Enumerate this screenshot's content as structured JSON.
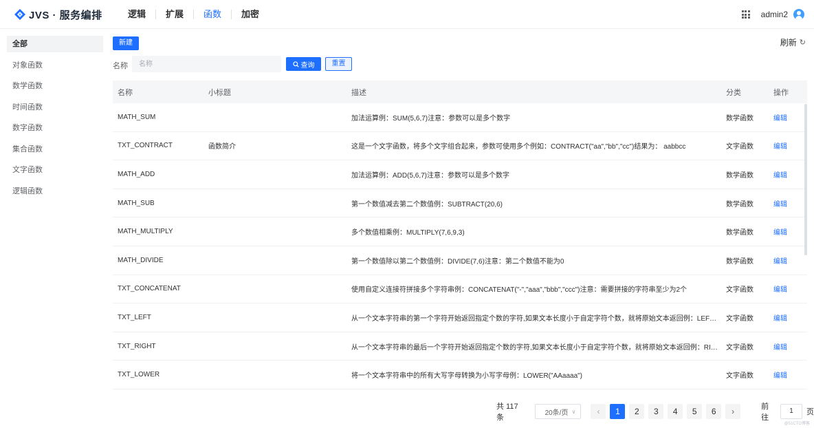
{
  "app": {
    "title": "JVS · 服务编排"
  },
  "nav": {
    "items": [
      "逻辑",
      "扩展",
      "函数",
      "加密"
    ],
    "active_index": 2
  },
  "user": {
    "name": "admin2"
  },
  "sidebar": {
    "items": [
      "全部",
      "对象函数",
      "数学函数",
      "时间函数",
      "数字函数",
      "集合函数",
      "文字函数",
      "逻辑函数"
    ],
    "active_index": 0
  },
  "toolbar": {
    "new_label": "新建",
    "refresh_label": "刷新"
  },
  "filter": {
    "label": "名称",
    "placeholder": "名称",
    "query_label": "查询",
    "reset_label": "重置"
  },
  "table": {
    "headers": {
      "name": "名称",
      "subtitle": "小标题",
      "desc": "描述",
      "category": "分类",
      "op": "操作"
    },
    "rows": [
      {
        "name": "MATH_SUM",
        "subtitle": "",
        "desc": "加法运算例：SUM(5,6,7)注意：参数可以是多个数字",
        "category": "数学函数",
        "op": "编辑"
      },
      {
        "name": "TXT_CONTRACT",
        "subtitle": "函数简介",
        "desc": "这是一个文字函数，将多个文字组合起来，参数可使用多个例如：CONTRACT(\"aa\",\"bb\",\"cc\")结果为： aabbcc",
        "category": "文字函数",
        "op": "编辑"
      },
      {
        "name": "MATH_ADD",
        "subtitle": "",
        "desc": "加法运算例：ADD(5,6,7)注意：参数可以是多个数字",
        "category": "数学函数",
        "op": "编辑"
      },
      {
        "name": "MATH_SUB",
        "subtitle": "",
        "desc": "第一个数值减去第二个数值例：SUBTRACT(20,6)",
        "category": "数学函数",
        "op": "编辑"
      },
      {
        "name": "MATH_MULTIPLY",
        "subtitle": "",
        "desc": "多个数值相乘例：MULTIPLY(7,6,9,3)",
        "category": "数学函数",
        "op": "编辑"
      },
      {
        "name": "MATH_DIVIDE",
        "subtitle": "",
        "desc": "第一个数值除以第二个数值例：DIVIDE(7,6)注意：第二个数值不能为0",
        "category": "数学函数",
        "op": "编辑"
      },
      {
        "name": "TXT_CONCATENAT",
        "subtitle": "",
        "desc": "使用自定义连接符拼接多个字符串例：CONCATENAT(\"-\",\"aaa\",\"bbb\",\"ccc\")注意：需要拼接的字符串至少为2个",
        "category": "文字函数",
        "op": "编辑"
      },
      {
        "name": "TXT_LEFT",
        "subtitle": "",
        "desc": "从一个文本字符串的第一个字符开始返回指定个数的字符,如果文本长度小于自定字符个数，就将原始文本返回例：LEFT…",
        "category": "文字函数",
        "op": "编辑"
      },
      {
        "name": "TXT_RIGHT",
        "subtitle": "",
        "desc": "从一个文本字符串的最后一个字符开始返回指定个数的字符,如果文本长度小于自定字符个数，就将原始文本返回例：RI…",
        "category": "文字函数",
        "op": "编辑"
      },
      {
        "name": "TXT_LOWER",
        "subtitle": "",
        "desc": "将一个文本字符串中的所有大写字母转换为小写字母例：LOWER(\"AAaaaa\")",
        "category": "文字函数",
        "op": "编辑"
      }
    ]
  },
  "pagination": {
    "total_text": "共 117 条",
    "page_size": "20条/页",
    "pages": [
      "1",
      "2",
      "3",
      "4",
      "5",
      "6"
    ],
    "current": "1",
    "goto_label": "前往",
    "goto_value": "1",
    "page_unit": "页"
  },
  "watermark": "@51CTO博客",
  "colors": {
    "accent": "#1e6fff"
  }
}
